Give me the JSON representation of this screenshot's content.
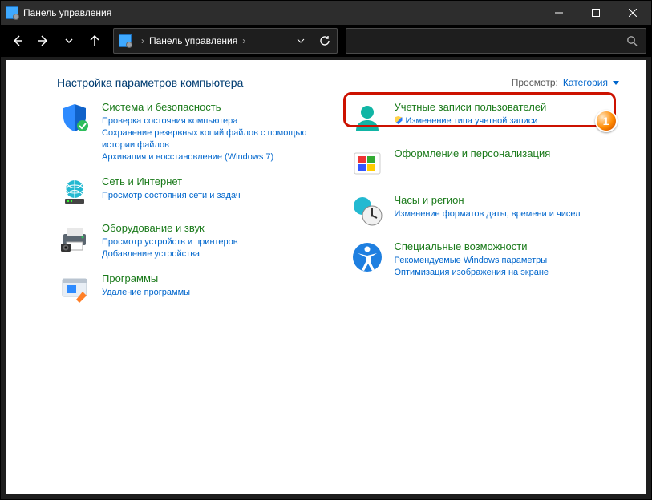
{
  "window": {
    "title": "Панель управления"
  },
  "address": {
    "root": "Панель управления"
  },
  "page": {
    "heading": "Настройка параметров компьютера",
    "view_label": "Просмотр:",
    "view_value": "Категория"
  },
  "left": {
    "system": {
      "title": "Система и безопасность",
      "links": [
        "Проверка состояния компьютера",
        "Сохранение резервных копий файлов с помощью истории файлов",
        "Архивация и восстановление (Windows 7)"
      ]
    },
    "network": {
      "title": "Сеть и Интернет",
      "links": [
        "Просмотр состояния сети и задач"
      ]
    },
    "hardware": {
      "title": "Оборудование и звук",
      "links": [
        "Просмотр устройств и принтеров",
        "Добавление устройства"
      ]
    },
    "programs": {
      "title": "Программы",
      "links": [
        "Удаление программы"
      ]
    }
  },
  "right": {
    "users": {
      "title": "Учетные записи пользователей",
      "links": [
        "Изменение типа учетной записи"
      ]
    },
    "appearance": {
      "title": "Оформление и персонализация"
    },
    "clock": {
      "title": "Часы и регион",
      "links": [
        "Изменение форматов даты, времени и чисел"
      ]
    },
    "ease": {
      "title": "Специальные возможности",
      "links": [
        "Рекомендуемые Windows параметры",
        "Оптимизация изображения на экране"
      ]
    }
  },
  "annotation": {
    "label": "1"
  }
}
